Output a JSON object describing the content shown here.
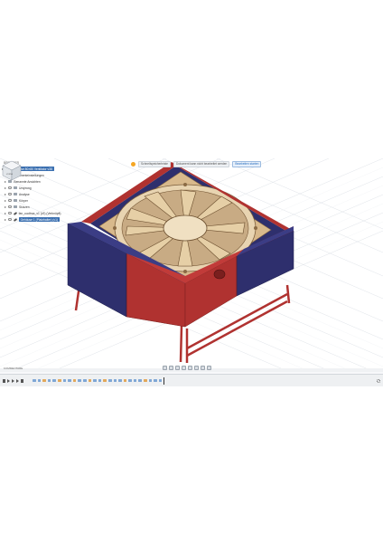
{
  "notification": {
    "save_chip": "Schnellspeicherleiste",
    "message": "Dokument kann nicht bearbeitet werden",
    "action": "Bearbeiten starten"
  },
  "browser": {
    "title": "BROWSER",
    "document": "Gehäuse 80×80 Ventilator v38",
    "items": [
      "Dokumenteinstellungen",
      "Benannte Ansichten",
      "Ursprung",
      "Analyse",
      "Körper",
      "Skizzen",
      "fan_cooltrax_v1 (v2) (Verknüpft)",
      "Gehäuse 1 (Platzhalter) (v1)"
    ]
  },
  "viewcube": {
    "face_label": "VORNE"
  },
  "comments": {
    "label": "KOMMENTARE"
  },
  "colors": {
    "blue": "#2e2f6d",
    "red": "#b03230",
    "fan": "#e2c69e",
    "accent": "#3a6fb0"
  },
  "icons": [
    "play-icon",
    "step-back-icon",
    "step-forward-icon",
    "gear-icon",
    "eye-icon",
    "folder-icon",
    "link-icon"
  ]
}
